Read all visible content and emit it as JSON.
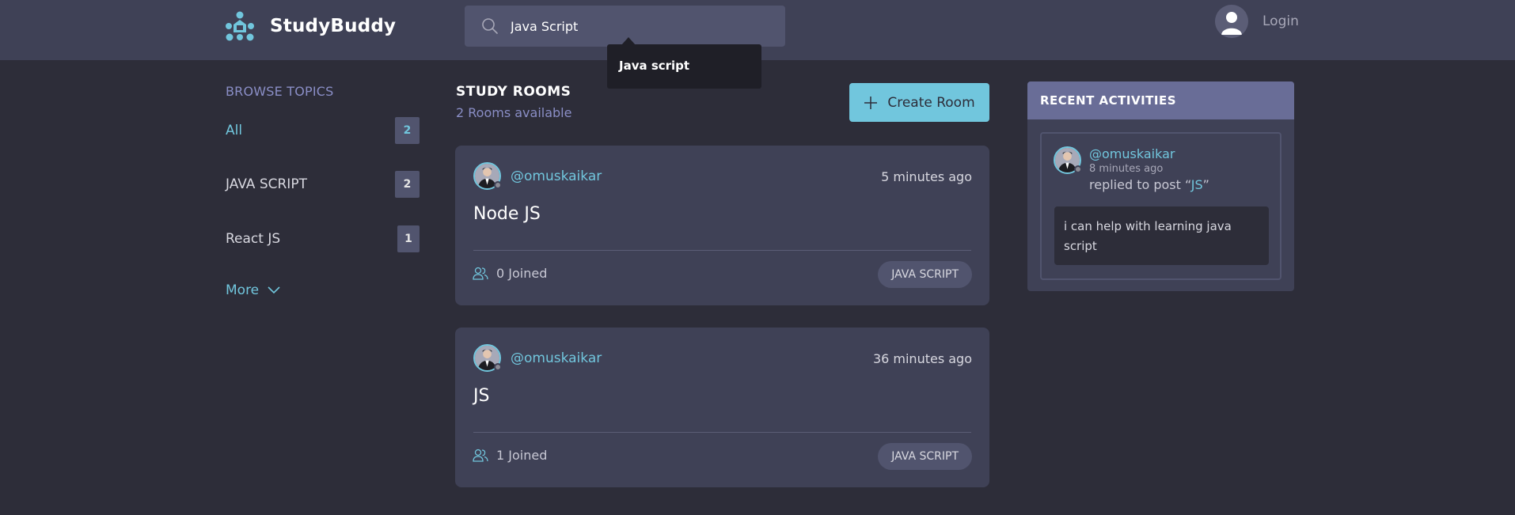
{
  "app": {
    "name": "StudyBuddy"
  },
  "header": {
    "search_value": "Java Script",
    "suggestion": "Java script",
    "login_label": "Login"
  },
  "topics": {
    "title": "BROWSE TOPICS",
    "items": [
      {
        "label": "All",
        "count": "2"
      },
      {
        "label": "JAVA SCRIPT",
        "count": "2"
      },
      {
        "label": "React JS",
        "count": "1"
      }
    ],
    "more_label": "More"
  },
  "rooms": {
    "title": "STUDY ROOMS",
    "subtitle": "2 Rooms available",
    "create_label": "Create Room",
    "items": [
      {
        "host": "@omuskaikar",
        "time": "5 minutes ago",
        "title": "Node JS",
        "joined": "0 Joined",
        "tag": "JAVA SCRIPT"
      },
      {
        "host": "@omuskaikar",
        "time": "36 minutes ago",
        "title": "JS",
        "joined": "1 Joined",
        "tag": "JAVA SCRIPT"
      }
    ]
  },
  "activities": {
    "title": "RECENT ACTIVITIES",
    "items": [
      {
        "user": "@omuskaikar",
        "time": "8 minutes ago",
        "action_prefix": "replied to post “",
        "action_target": "JS",
        "action_suffix": "”",
        "message": "i can help with learning java script"
      }
    ]
  },
  "colors": {
    "accent": "#71c6dd",
    "header_bg": "#3f4156",
    "page_bg": "#2d2d39",
    "muted_purple": "#8a8ec6"
  },
  "icons": [
    "logo-icon",
    "search-icon",
    "user-avatar-icon",
    "chevron-down-icon",
    "plus-icon",
    "users-icon"
  ]
}
